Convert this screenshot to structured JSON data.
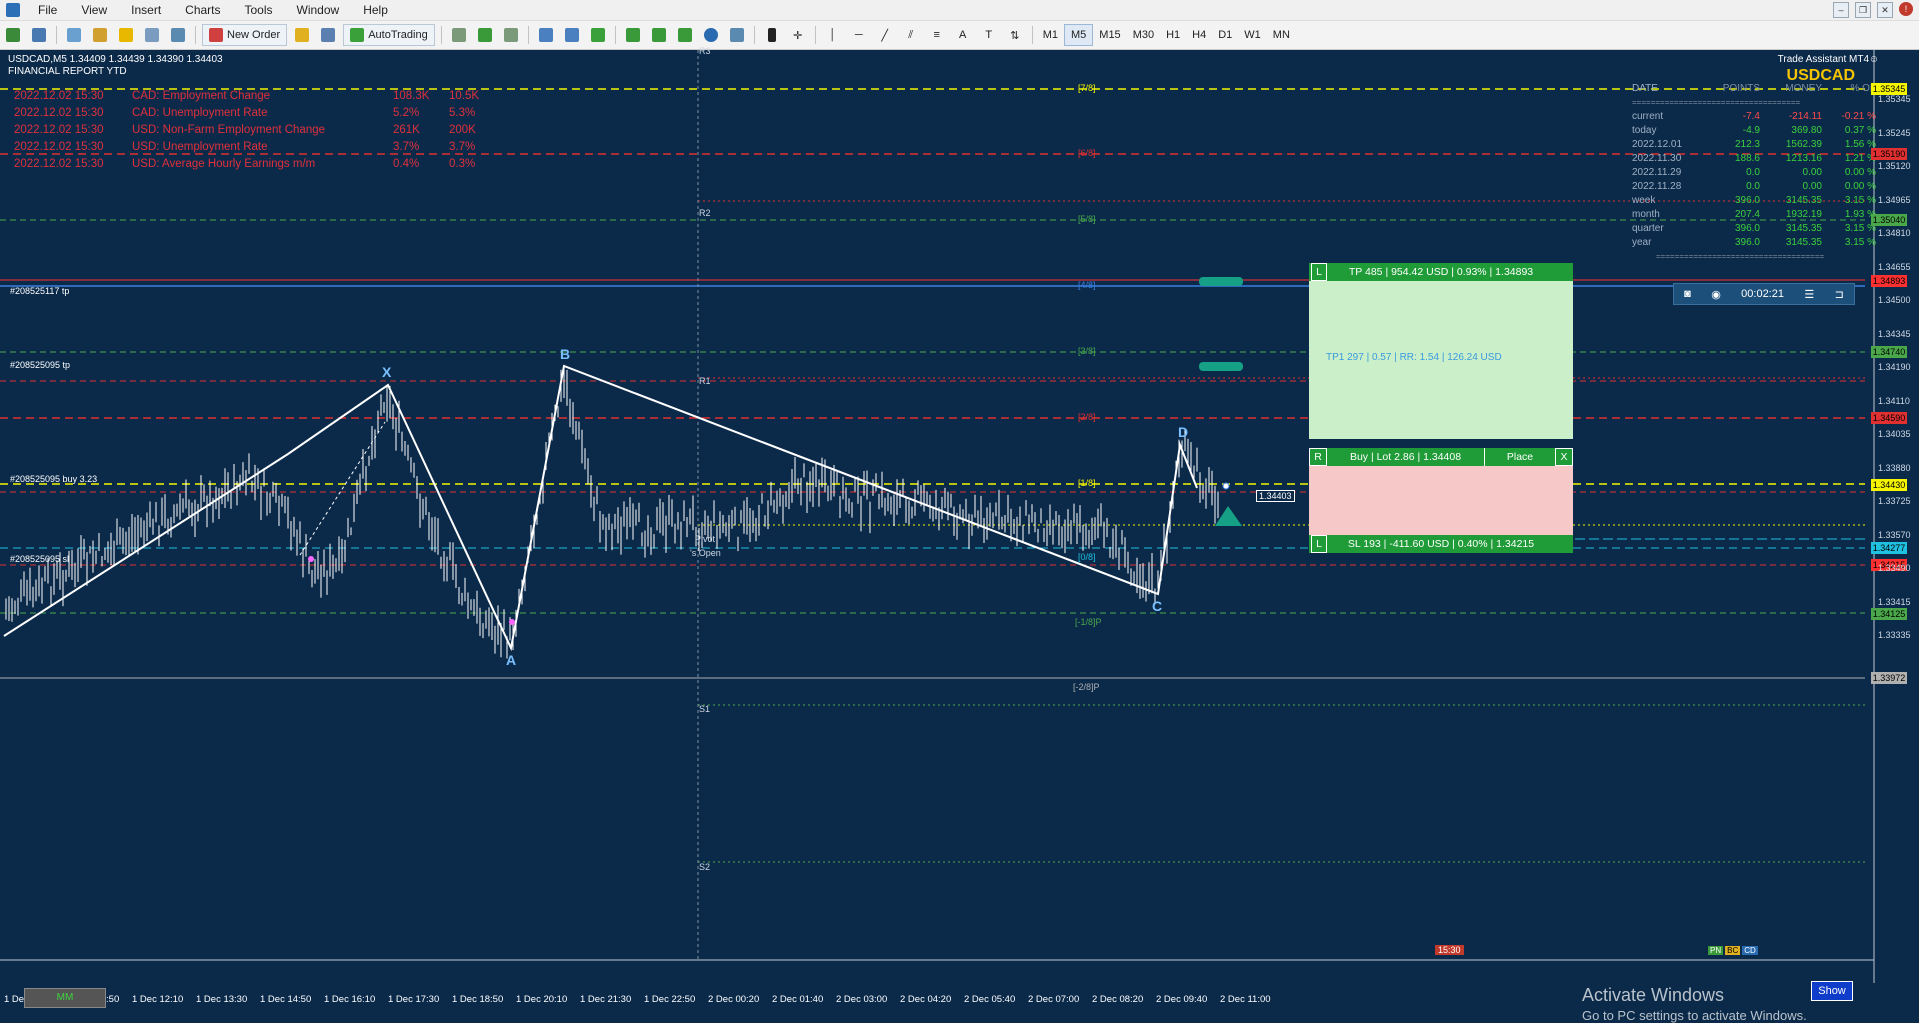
{
  "menu": {
    "items": [
      "File",
      "View",
      "Insert",
      "Charts",
      "Tools",
      "Window",
      "Help"
    ]
  },
  "toolbar": {
    "new_order": "New Order",
    "autotrading": "AutoTrading",
    "timeframes": [
      "M1",
      "M5",
      "M15",
      "M30",
      "H1",
      "H4",
      "D1",
      "W1",
      "MN"
    ],
    "active_tf": "M5"
  },
  "chart": {
    "symbol_header": "USDCAD,M5  1.34409 1.34439 1.34390 1.34403",
    "report_title": "FINANCIAL REPORT YTD",
    "news": [
      {
        "date": "2022.12.02 15:30",
        "event": "CAD: Employment Change",
        "actual": "108.3K",
        "forecast": "10.5K"
      },
      {
        "date": "2022.12.02 15:30",
        "event": "CAD: Unemployment Rate",
        "actual": "5.2%",
        "forecast": "5.3%"
      },
      {
        "date": "2022.12.02 15:30",
        "event": "USD: Non-Farm Employment Change",
        "actual": "261K",
        "forecast": "200K"
      },
      {
        "date": "2022.12.02 15:30",
        "event": "USD: Unemployment Rate",
        "actual": "3.7%",
        "forecast": "3.7%"
      },
      {
        "date": "2022.12.02 15:30",
        "event": "USD: Average Hourly Earnings m/m",
        "actual": "0.4%",
        "forecast": "0.3%"
      }
    ],
    "trade_assistant_title": "Trade Assistant MT4",
    "trade_assistant_symbol": "USDCAD",
    "stats_header": [
      "DATE",
      "POINTS",
      "MONEY",
      "% OF"
    ],
    "stats": [
      {
        "label": "current",
        "points": "-7.4",
        "money": "-214.11",
        "pct": "-0.21 %",
        "color": "#ff4b4b"
      },
      {
        "label": "today",
        "points": "-4.9",
        "money": "369.80",
        "pct": "0.37 %",
        "color": "#3ad13a"
      },
      {
        "label": "2022.12.01",
        "points": "212.3",
        "money": "1562.39",
        "pct": "1.56 %",
        "color": "#3ad13a"
      },
      {
        "label": "2022.11.30",
        "points": "188.6",
        "money": "1213.16",
        "pct": "1.21 %",
        "color": "#3ad13a"
      },
      {
        "label": "2022.11.29",
        "points": "0.0",
        "money": "0.00",
        "pct": "0.00 %",
        "color": "#3ad13a"
      },
      {
        "label": "2022.11.28",
        "points": "0.0",
        "money": "0.00",
        "pct": "0.00 %",
        "color": "#3ad13a"
      },
      {
        "label": "week",
        "points": "396.0",
        "money": "3145.35",
        "pct": "3.15 %",
        "color": "#3ad13a"
      },
      {
        "label": "month",
        "points": "207.4",
        "money": "1932.19",
        "pct": "1.93 %",
        "color": "#3ad13a"
      },
      {
        "label": "quarter",
        "points": "396.0",
        "money": "3145.35",
        "pct": "3.15 %",
        "color": "#3ad13a"
      },
      {
        "label": "year",
        "points": "396.0",
        "money": "3145.35",
        "pct": "3.15 %",
        "color": "#3ad13a"
      }
    ],
    "stats_separator": "====================================",
    "tp_label": "TP 485 | 954.42 USD | 0.93% | 1.34893",
    "tp1_label": "TP1 297 | 0.57 | RR: 1.54 | 126.24 USD",
    "buy_label": "Buy | Lot 2.86 | 1.34408",
    "place_label": "Place",
    "sl_label": "SL 193 | -411.60 USD | 0.40% | 1.34215",
    "letter_L": "L",
    "letter_R": "R",
    "letter_X": "X",
    "timer": "00:02:21",
    "current_price": "1.34403",
    "order_labels": {
      "tp": "#208525117 tp",
      "tp2": "#208525095 tp",
      "buy": "#208525095 buy 3.23",
      "sl": "#208525095 sl"
    },
    "pivot_labels": [
      "R3",
      "R2",
      "R1",
      "Pivot",
      "S1",
      "S2"
    ],
    "pivot_extra": "'s Open",
    "murrey_labels": [
      "[7/8]",
      "[6/8]",
      "[5/8]",
      "[4/8]",
      "[3/8]",
      "[2/8]",
      "[1/8]",
      "[0/8]",
      "[-1/8]P",
      "[-2/8]P"
    ],
    "pattern_points": [
      "X",
      "A",
      "B",
      "C",
      "D"
    ],
    "price_axis": [
      "1.35345",
      "1.35245",
      "1.35120",
      "1.34965",
      "1.34810",
      "1.34655",
      "1.34500",
      "1.34345",
      "1.34190",
      "1.34110",
      "1.34035",
      "1.33880",
      "1.33725",
      "1.33570",
      "1.33490",
      "1.33415",
      "1.33335"
    ],
    "price_tags": [
      {
        "text": "1.35345",
        "bg": "#f5f500"
      },
      {
        "text": "1.35190",
        "bg": "#e03030"
      },
      {
        "text": "1.35040",
        "bg": "#4aa84a"
      },
      {
        "text": "1.34893",
        "bg": "#ff3030"
      },
      {
        "text": "1.34740",
        "bg": "#4aa84a"
      },
      {
        "text": "1.34590",
        "bg": "#e03030"
      },
      {
        "text": "1.34430",
        "bg": "#f5f500"
      },
      {
        "text": "1.34277",
        "bg": "#20c0e0"
      },
      {
        "text": "1.34215",
        "bg": "#ff3030"
      },
      {
        "text": "1.34125",
        "bg": "#4aa84a"
      },
      {
        "text": "1.33972",
        "bg": "#b0b0b0"
      }
    ],
    "time_axis": [
      "1 Dec 2022",
      "1 Dec 10:50",
      "1 Dec 12:10",
      "1 Dec 13:30",
      "1 Dec 14:50",
      "1 Dec 16:10",
      "1 Dec 17:30",
      "1 Dec 18:50",
      "1 Dec 20:10",
      "1 Dec 21:30",
      "1 Dec 22:50",
      "2 Dec 00:20",
      "2 Dec 01:40",
      "2 Dec 03:00",
      "2 Dec 04:20",
      "2 Dec 05:40",
      "2 Dec 07:00",
      "2 Dec 08:20",
      "2 Dec 09:40",
      "2 Dec 11:00"
    ],
    "mm_button": "MM",
    "show_button": "Show",
    "news_time_marker": "15:30",
    "activate_line1": "Activate Windows",
    "activate_line2": "Go to PC settings to activate Windows.",
    "mini_buttons": [
      "PN",
      "BC",
      "CD"
    ]
  }
}
